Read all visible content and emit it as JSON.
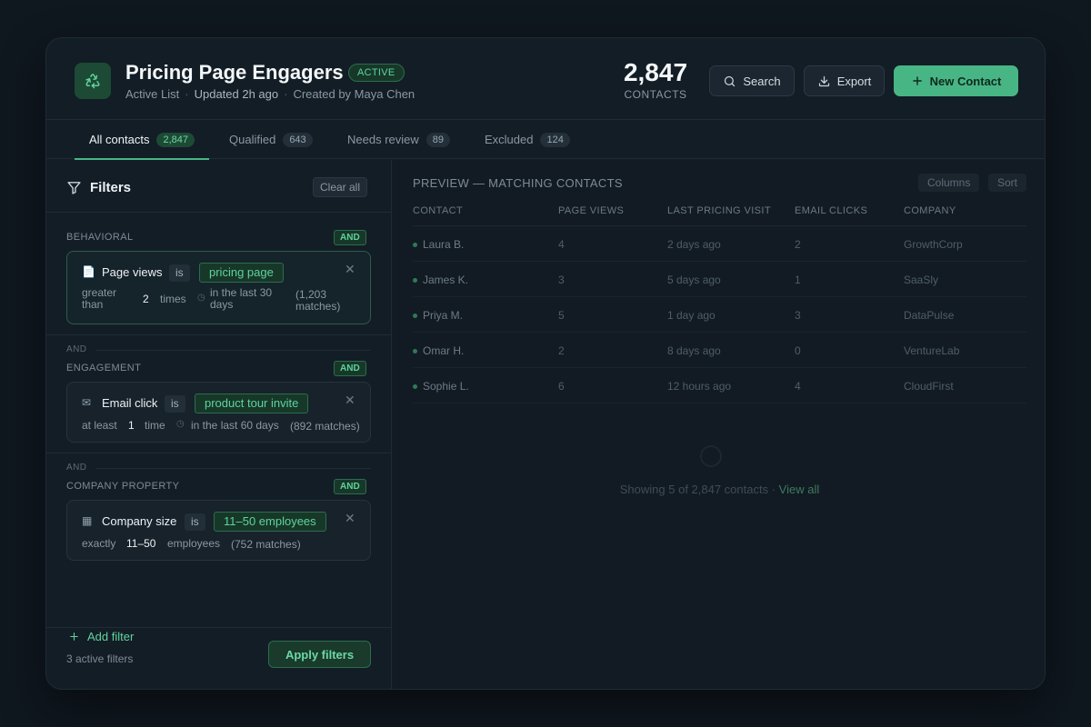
{
  "header": {
    "title": "Pricing Page Engagers",
    "status_badge": "ACTIVE",
    "list_type": "Active List",
    "updated": "Updated 2h ago",
    "created_by": "Created by Maya Chen",
    "contact_count": "2,847",
    "contact_count_label": "CONTACTS",
    "search_label": "Search",
    "export_label": "Export",
    "new_contact_label": "New Contact"
  },
  "tabs": [
    {
      "label": "All contacts",
      "count": "2,847"
    },
    {
      "label": "Qualified",
      "count": "643"
    },
    {
      "label": "Needs review",
      "count": "89"
    },
    {
      "label": "Excluded",
      "count": "124"
    }
  ],
  "filters": {
    "title": "Filters",
    "clear_all": "Clear all",
    "and_separator": "AND",
    "groups": [
      {
        "label": "BEHAVIORAL",
        "combinator": "AND",
        "field": "Page views",
        "icon": "document-icon",
        "operator": "is",
        "value": "pricing page",
        "qualifier": "greater than",
        "number": "2",
        "unit": "times",
        "window": "in the last 30 days",
        "matches": "(1,203 matches)"
      },
      {
        "label": "ENGAGEMENT",
        "combinator": "AND",
        "field": "Email click",
        "icon": "envelope-icon",
        "operator": "is",
        "value": "product tour invite",
        "qualifier": "at least",
        "number": "1",
        "unit": "time",
        "window": "in the last 60 days",
        "matches": "(892 matches)"
      },
      {
        "label": "COMPANY PROPERTY",
        "combinator": "AND",
        "field": "Company size",
        "icon": "building-icon",
        "operator": "is",
        "value": "11–50 employees",
        "qualifier": "exactly",
        "number": "11–50",
        "unit": "employees",
        "matches": "(752 matches)"
      }
    ],
    "add_filter": "Add filter",
    "active_count": "3 active filters",
    "apply": "Apply filters"
  },
  "preview": {
    "title": "PREVIEW — MATCHING CONTACTS",
    "columns_btn": "Columns",
    "sort_btn": "Sort",
    "headers": [
      "CONTACT",
      "PAGE VIEWS",
      "LAST PRICING VISIT",
      "EMAIL CLICKS",
      "COMPANY"
    ],
    "rows": [
      [
        "Laura B.",
        "4",
        "2 days ago",
        "2",
        "GrowthCorp"
      ],
      [
        "James K.",
        "3",
        "5 days ago",
        "1",
        "SaaSly"
      ],
      [
        "Priya M.",
        "5",
        "1 day ago",
        "3",
        "DataPulse"
      ],
      [
        "Omar H.",
        "2",
        "8 days ago",
        "0",
        "VentureLab"
      ],
      [
        "Sophie L.",
        "6",
        "12 hours ago",
        "4",
        "CloudFirst"
      ]
    ],
    "showing": "Showing 5 of 2,847 contacts ·",
    "view_all": "View all"
  },
  "colors": {
    "accent": "#48b585",
    "accent_text": "#5fd39c",
    "background": "#0f171f",
    "card": "#131d26"
  }
}
